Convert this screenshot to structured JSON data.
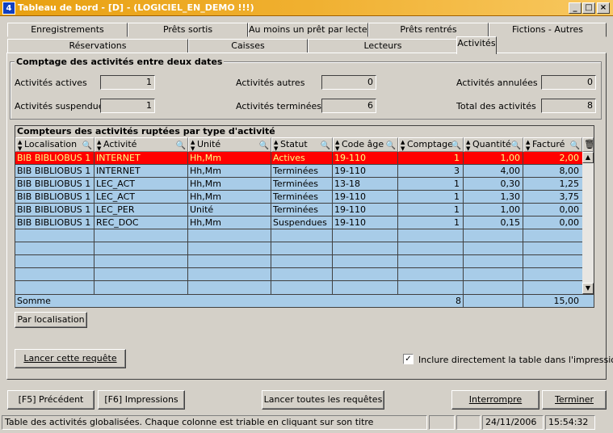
{
  "window": {
    "title": "Tableau de bord  - [D] - (LOGICIEL_EN_DEMO !!!)",
    "app_icon": "4",
    "controls": [
      "_",
      "□",
      "×"
    ]
  },
  "tabs_row1": [
    "Enregistrements",
    "Prêts sortis",
    "Au moins un prêt par lecteur",
    "Prêts rentrés",
    "Fictions - Autres"
  ],
  "tabs_row2": [
    "Réservations",
    "Caisses",
    "Lecteurs",
    "Activités"
  ],
  "active_tab": "Activités",
  "counts": {
    "group_title": "Comptage des activités entre deux dates",
    "actives_label": "Activités actives",
    "actives_value": "1",
    "autres_label": "Activités autres",
    "autres_value": "0",
    "annulees_label": "Activités annulées",
    "annulees_value": "0",
    "suspendues_label": "Activités suspendues",
    "suspendues_value": "1",
    "terminees_label": "Activités terminées",
    "terminees_value": "6",
    "total_label": "Total des activités",
    "total_value": "8"
  },
  "table": {
    "title": "Compteurs des activités ruptées par type d'activité",
    "columns": [
      "Localisation",
      "Activité",
      "Unité",
      "Statut",
      "Code âge",
      "Comptage",
      "Quantité",
      "Facturé"
    ],
    "rows": [
      [
        "BIB BIBLIOBUS 1",
        "INTERNET",
        "Hh,Mm",
        "Actives",
        "19-110",
        "1",
        "1,00",
        "2,00"
      ],
      [
        "BIB BIBLIOBUS 1",
        "INTERNET",
        "Hh,Mm",
        "Terminées",
        "19-110",
        "3",
        "4,00",
        "8,00"
      ],
      [
        "BIB BIBLIOBUS 1",
        "LEC_ACT",
        "Hh,Mm",
        "Terminées",
        "13-18",
        "1",
        "0,30",
        "1,25"
      ],
      [
        "BIB BIBLIOBUS 1",
        "LEC_ACT",
        "Hh,Mm",
        "Terminées",
        "19-110",
        "1",
        "1,30",
        "3,75"
      ],
      [
        "BIB BIBLIOBUS 1",
        "LEC_PER",
        "Unité",
        "Terminées",
        "19-110",
        "1",
        "1,00",
        "0,00"
      ],
      [
        "BIB BIBLIOBUS 1",
        "REC_DOC",
        "Hh,Mm",
        "Suspendues",
        "19-110",
        "1",
        "0,15",
        "0,00"
      ]
    ],
    "sum_label": "Somme",
    "sum_comptage": "8",
    "sum_facture": "15,00"
  },
  "buttons": {
    "par_localisation": "Par localisation",
    "lancer_requete": "Lancer cette requête",
    "inclure_label": "Inclure directement la table dans l'impression",
    "inclure_checked": "✓",
    "precedent": "[F5] Précédent",
    "impressions": "[F6] Impressions",
    "lancer_toutes": "Lancer toutes les requêtes",
    "interrompre": "Interrompre",
    "terminer": "Terminer"
  },
  "status": {
    "message": "Table des activités globalisées. Chaque colonne est triable en cliquant sur son titre",
    "date": "24/11/2006",
    "time": "15:54:32"
  },
  "colors": {
    "selected_row": "#ff0000",
    "row_bg": "#a8cce8",
    "titlebar": "#e8a010"
  }
}
